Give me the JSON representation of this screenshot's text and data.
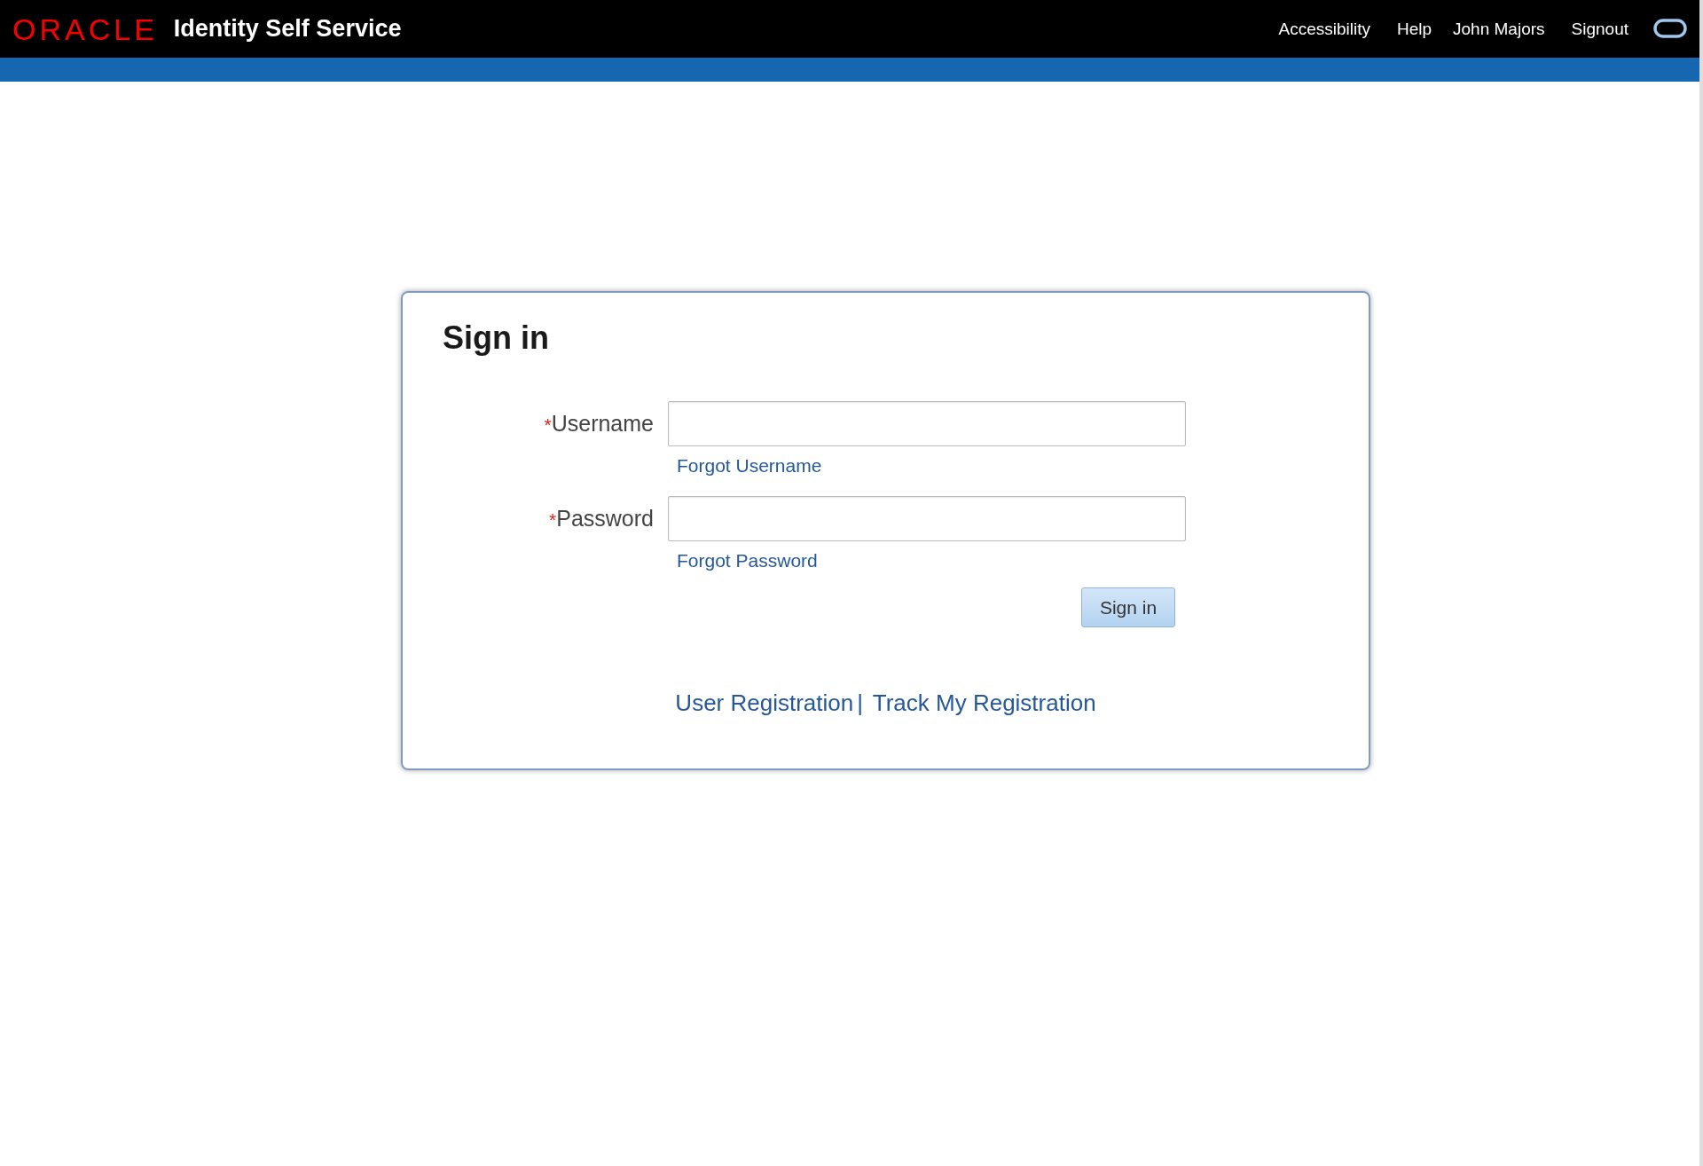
{
  "header": {
    "logo": "ORACLE",
    "app_title": "Identity Self Service",
    "links": [
      "Accessibility",
      "Help",
      "John Majors",
      "Signout"
    ]
  },
  "sign_in": {
    "title": "Sign in",
    "fields": [
      {
        "label": "Username",
        "required": true,
        "link": "Forgot Username"
      },
      {
        "label": "Password",
        "required": true,
        "link": "Forgot Password"
      }
    ],
    "required_mark": "*",
    "button": "Sign in",
    "footer_links": [
      "User Registration",
      "Track My Registration"
    ],
    "separator": "|"
  }
}
